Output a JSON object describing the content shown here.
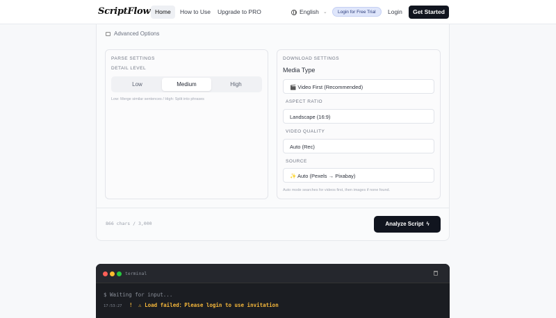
{
  "nav": {
    "logo": "ScriptFlow",
    "links": [
      "Home",
      "How to Use",
      "Upgrade to PRO"
    ],
    "language": "English",
    "trial": "Login for Free Trial",
    "login": "Login",
    "get_started": "Get Started"
  },
  "advanced": {
    "label": "Advanced Options"
  },
  "parse": {
    "title": "PARSE SETTINGS",
    "detail_label": "DETAIL LEVEL",
    "options": [
      "Low",
      "Medium",
      "High"
    ],
    "selected": "Medium",
    "hint": "Low: Merge similar sentences / High: Split into phrases"
  },
  "download": {
    "title": "DOWNLOAD SETTINGS",
    "media_type_label": "Media Type",
    "media_type_value": "🎬 Video First (Recommended)",
    "aspect_label": "ASPECT RATIO",
    "aspect_value": "Landscape (16:9)",
    "quality_label": "VIDEO QUALITY",
    "quality_value": "Auto (Rec)",
    "source_label": "SOURCE",
    "source_value": "✨ Auto (Pexels → Pixabay)",
    "hint": "Auto mode searches for videos first, then images if none found."
  },
  "footer": {
    "chars": "866 chars",
    "limit": "/ 3,000",
    "analyze": "Analyze Script"
  },
  "terminal": {
    "title": "terminal",
    "waiting": "$ Waiting for input...",
    "timestamp": "17:53:27",
    "error_prefix": "!",
    "error_text": "⚠ Load failed：Please login to use invitation"
  },
  "colors": {
    "dot_red": "#ff5f57",
    "dot_yellow": "#febc2e",
    "dot_green": "#28c840",
    "warn": "#f4b63a"
  }
}
